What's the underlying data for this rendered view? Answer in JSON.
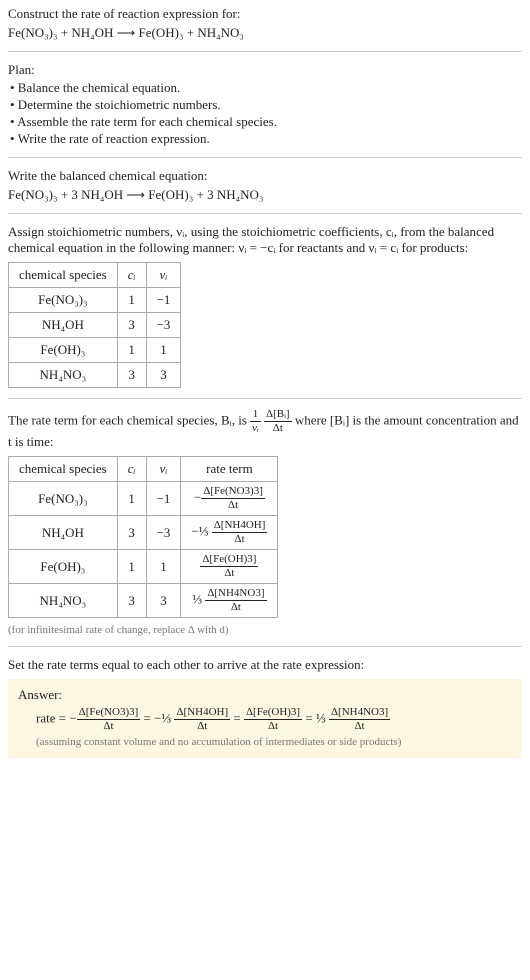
{
  "header": {
    "prompt": "Construct the rate of reaction expression for:",
    "equation": "Fe(NO₃)₃ + NH₄OH ⟶ Fe(OH)₃ + NH₄NO₃"
  },
  "plan": {
    "title": "Plan:",
    "items": [
      "• Balance the chemical equation.",
      "• Determine the stoichiometric numbers.",
      "• Assemble the rate term for each chemical species.",
      "• Write the rate of reaction expression."
    ]
  },
  "balanced": {
    "title": "Write the balanced chemical equation:",
    "equation": "Fe(NO₃)₃ + 3 NH₄OH ⟶ Fe(OH)₃ + 3 NH₄NO₃"
  },
  "stoich_intro": "Assign stoichiometric numbers, νᵢ, using the stoichiometric coefficients, cᵢ, from the balanced chemical equation in the following manner: νᵢ = −cᵢ for reactants and νᵢ = cᵢ for products:",
  "table1": {
    "headers": [
      "chemical species",
      "cᵢ",
      "νᵢ"
    ],
    "rows": [
      {
        "species": "Fe(NO₃)₃",
        "c": "1",
        "nu": "−1"
      },
      {
        "species": "NH₄OH",
        "c": "3",
        "nu": "−3"
      },
      {
        "species": "Fe(OH)₃",
        "c": "1",
        "nu": "1"
      },
      {
        "species": "NH₄NO₃",
        "c": "3",
        "nu": "3"
      }
    ]
  },
  "rate_intro_a": "The rate term for each chemical species, Bᵢ, is ",
  "rate_intro_frac": {
    "num": "1",
    "den": "νᵢ",
    "num2": "Δ[Bᵢ]",
    "den2": "Δt"
  },
  "rate_intro_b": " where [Bᵢ] is the amount concentration and t is time:",
  "table2": {
    "headers": [
      "chemical species",
      "cᵢ",
      "νᵢ",
      "rate term"
    ],
    "rows": [
      {
        "species": "Fe(NO₃)₃",
        "c": "1",
        "nu": "−1",
        "pref": "−",
        "num": "Δ[Fe(NO3)3]",
        "den": "Δt"
      },
      {
        "species": "NH₄OH",
        "c": "3",
        "nu": "−3",
        "pref": "−⅓ ",
        "num": "Δ[NH4OH]",
        "den": "Δt"
      },
      {
        "species": "Fe(OH)₃",
        "c": "1",
        "nu": "1",
        "pref": "",
        "num": "Δ[Fe(OH)3]",
        "den": "Δt"
      },
      {
        "species": "NH₄NO₃",
        "c": "3",
        "nu": "3",
        "pref": "⅓ ",
        "num": "Δ[NH4NO3]",
        "den": "Δt"
      }
    ]
  },
  "inf_note": "(for infinitesimal rate of change, replace Δ with d)",
  "final_title": "Set the rate terms equal to each other to arrive at the rate expression:",
  "answer": {
    "label": "Answer:",
    "prefix": "rate = −",
    "t1": {
      "num": "Δ[Fe(NO3)3]",
      "den": "Δt"
    },
    "eq1": " = −⅓ ",
    "t2": {
      "num": "Δ[NH4OH]",
      "den": "Δt"
    },
    "eq2": " = ",
    "t3": {
      "num": "Δ[Fe(OH)3]",
      "den": "Δt"
    },
    "eq3": " = ⅓ ",
    "t4": {
      "num": "Δ[NH4NO3]",
      "den": "Δt"
    },
    "note": "(assuming constant volume and no accumulation of intermediates or side products)"
  }
}
